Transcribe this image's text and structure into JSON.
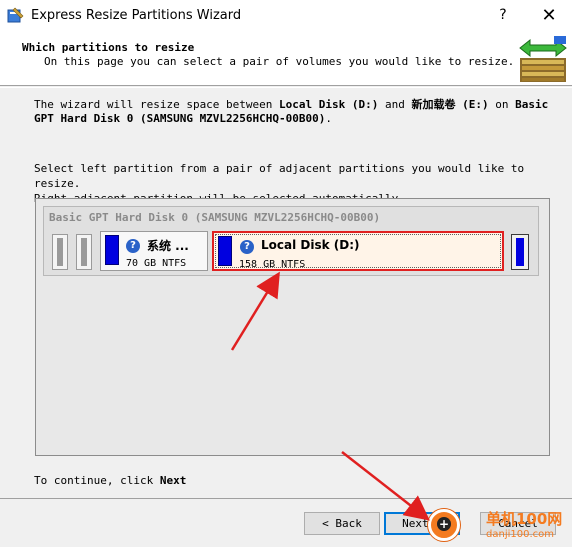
{
  "window": {
    "title": "Express Resize Partitions Wizard",
    "help_label": "?",
    "close_label": "✕"
  },
  "header": {
    "title": "Which partitions to resize",
    "subtitle": "On this page you can select a pair of volumes you would like to resize."
  },
  "intro": {
    "prefix": "The wizard will resize space between ",
    "disk_d": "Local Disk (D:)",
    "and": " and ",
    "disk_e": "新加载卷 (E:)",
    "on": " on ",
    "disk": "Basic GPT Hard Disk 0 (SAMSUNG MZVL2256HCHQ-00B00)",
    "suffix": "."
  },
  "instruction": {
    "line1": "Select left partition from a pair of adjacent partitions you would like to resize.",
    "line2": "Right adjacent partition will be selected automatically."
  },
  "disk_map": {
    "disk_label": "Basic GPT Hard Disk 0 (SAMSUNG MZVL2256HCHQ-00B00)",
    "partitions": [
      {
        "name": "系统 ...",
        "size": "70 GB NTFS",
        "selected": false
      },
      {
        "name": "Local Disk (D:)",
        "size": "158 GB NTFS",
        "selected": true
      }
    ]
  },
  "continue": {
    "prefix": "To continue, click ",
    "target": "Next"
  },
  "buttons": {
    "back": "< Back",
    "next": "Next >",
    "cancel": "Cancel"
  },
  "watermark": {
    "title": "单机100网",
    "url": "danji100.com"
  },
  "colors": {
    "selection_border": "#e02020",
    "arrow": "#e02020",
    "partition_fill": "#0000e0",
    "watermark": "#f47b20"
  }
}
